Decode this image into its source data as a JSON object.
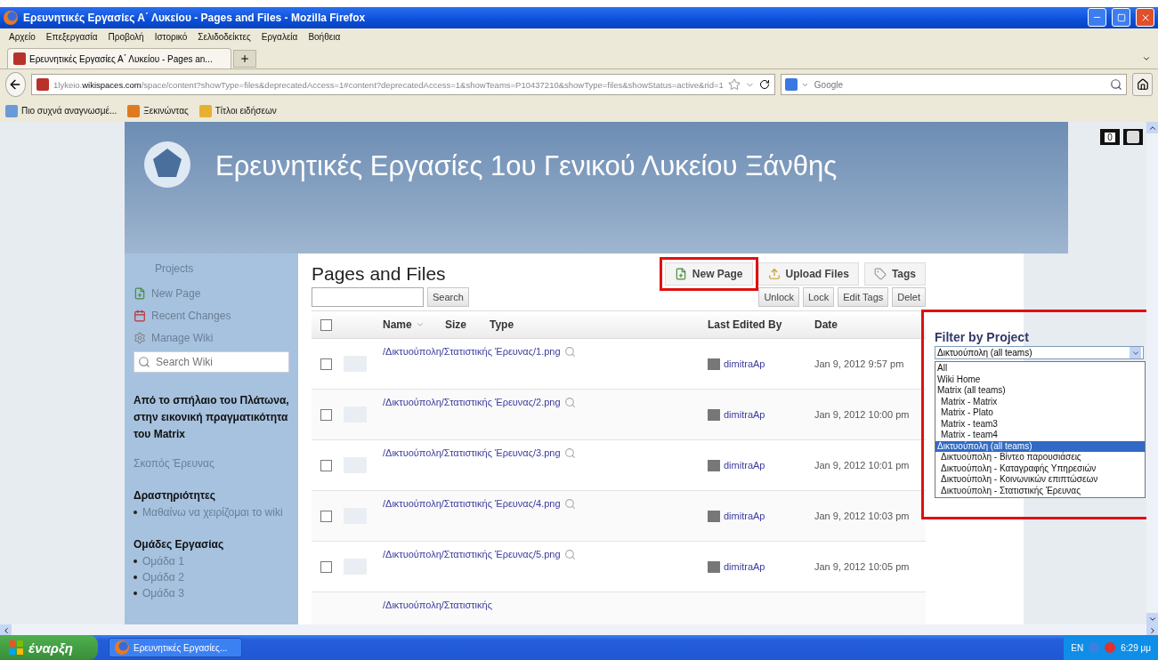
{
  "window": {
    "title": "Ερευνητικές Εργασίες Α΄ Λυκείου - Pages and Files - Mozilla Firefox"
  },
  "menu_bar": [
    "Αρχείο",
    "Επεξεργασία",
    "Προβολή",
    "Ιστορικό",
    "Σελιδοδείκτες",
    "Εργαλεία",
    "Βοήθεια"
  ],
  "tabs": [
    {
      "label": "Ερευνητικές Εργασίες Α΄ Λυκείου - Pages an...",
      "selected": true
    }
  ],
  "address_bar": {
    "url": "1lykeio.**wikispaces.com**/space/content?showType=files&deprecatedAccess=1#content?deprecatedAccess=1&showTeams=P10437210&showType=files&showStatus=active&rid=1"
  },
  "search_box": {
    "placeholder": "Google"
  },
  "bookmarks": [
    "Πιο συχνά αναγνωσμέ...",
    "Ξεκινώντας",
    "Τίτλοι ειδήσεων"
  ],
  "page_badge": {
    "count": "0"
  },
  "site": {
    "title": "Ερευνητικές Εργασίες 1ου Γενικού Λυκείου Ξάνθης"
  },
  "sidebar": {
    "header": "Projects",
    "links": [
      {
        "kind": "new_page",
        "label": "New Page"
      },
      {
        "kind": "changes",
        "label": "Recent Changes"
      },
      {
        "kind": "manage",
        "label": "Manage Wiki"
      }
    ],
    "search": {
      "placeholder": "Search Wiki"
    },
    "sections": [
      {
        "kind": "heading",
        "text": "Από το σπήλαιο του Πλάτωνα, στην εικονική πραγματικότητα του Matrix"
      },
      {
        "kind": "link",
        "text": "Σκοπός Έρευνας"
      },
      {
        "kind": "heading",
        "text": "Δραστηριότητες"
      },
      {
        "kind": "bullet",
        "text": "Μαθαίνω να χειρίζομαι το wiki"
      },
      {
        "kind": "heading",
        "text": "Ομάδες Εργασίας"
      },
      {
        "kind": "bullet",
        "text": "Ομάδα 1"
      },
      {
        "kind": "bullet",
        "text": "Ομάδα 2"
      },
      {
        "kind": "bullet",
        "text": "Ομάδα 3"
      }
    ]
  },
  "content": {
    "title": "Pages and Files",
    "actions": [
      {
        "kind": "new_page",
        "label": "New Page",
        "highlighted": true
      },
      {
        "kind": "upload",
        "label": "Upload Files",
        "highlighted": false
      },
      {
        "kind": "tags",
        "label": "Tags",
        "highlighted": false
      }
    ],
    "search_button": "Search",
    "bulk_actions": [
      "Unlock",
      "Lock",
      "Edit Tags",
      "Delet"
    ],
    "table": {
      "all_checked": false,
      "columns": [
        "Name",
        "Size",
        "Type",
        "Last Edited By",
        "Date"
      ],
      "rows": [
        {
          "name": "/Δικτυούπολη/Στατιστικής Έρευνας/1.png",
          "checked": false,
          "editor": "dimitraAp",
          "date": "Jan 9, 2012 9:57 pm"
        },
        {
          "name": "/Δικτυούπολη/Στατιστικής Έρευνας/2.png",
          "checked": false,
          "editor": "dimitraAp",
          "date": "Jan 9, 2012 10:00 pm"
        },
        {
          "name": "/Δικτυούπολη/Στατιστικής Έρευνας/3.png",
          "checked": false,
          "editor": "dimitraAp",
          "date": "Jan 9, 2012 10:01 pm"
        },
        {
          "name": "/Δικτυούπολη/Στατιστικής Έρευνας/4.png",
          "checked": false,
          "editor": "dimitraAp",
          "date": "Jan 9, 2012 10:03 pm"
        },
        {
          "name": "/Δικτυούπολη/Στατιστικής Έρευνας/5.png",
          "checked": false,
          "editor": "dimitraAp",
          "date": "Jan 9, 2012 10:05 pm"
        },
        {
          "name": "/Δικτυούπολη/Στατιστικής"
        }
      ]
    }
  },
  "filter": {
    "label": "Filter by Project",
    "value": "Δικτυούπολη (all teams)",
    "expanded": true,
    "highlighted": true,
    "options": [
      {
        "label": "All",
        "selected": false
      },
      {
        "label": "Wiki Home",
        "selected": false
      },
      {
        "label": "Matrix (all teams)",
        "selected": false,
        "children": [
          {
            "label": "Matrix - Matrix",
            "selected": false
          },
          {
            "label": "Matrix - Plato",
            "selected": false
          },
          {
            "label": "Matrix - team3",
            "selected": false
          },
          {
            "label": "Matrix - team4",
            "selected": false
          }
        ]
      },
      {
        "label": "Δικτυούπολη (all teams)",
        "selected": true,
        "children": [
          {
            "label": "Δικτυούπολη - Βίντεο παρουσιάσεις",
            "selected": false
          },
          {
            "label": "Δικτυούπολη - Καταγραφής Υπηρεσιών",
            "selected": false
          },
          {
            "label": "Δικτυούπολη - Κοινωνικών επιπτώσεων",
            "selected": false
          },
          {
            "label": "Δικτυούπολη - Στατιστικής Έρευνας",
            "selected": false
          }
        ]
      }
    ]
  },
  "taskbar": {
    "start": "έναρξη",
    "tasks": [
      "Ερευνητικές Εργασίες..."
    ],
    "language": "EN",
    "clock": "6:29 μμ"
  }
}
